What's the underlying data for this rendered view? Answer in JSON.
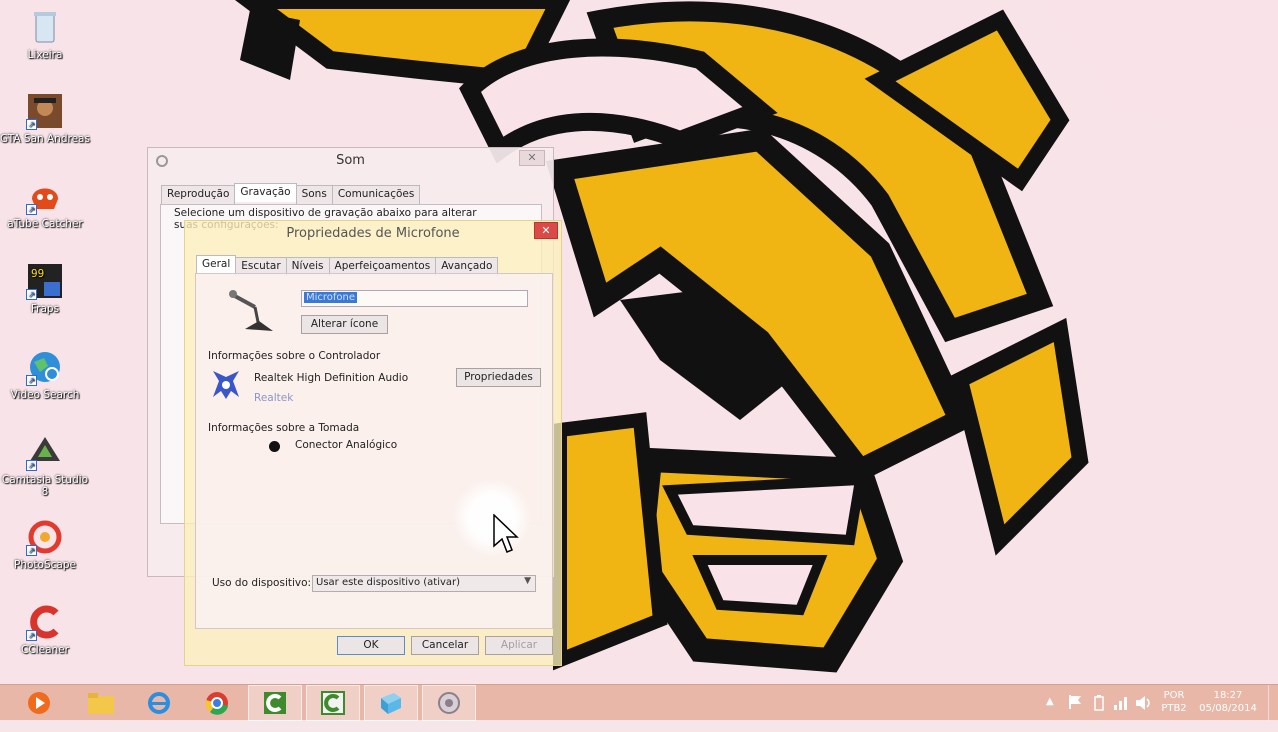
{
  "desktop": {
    "icons": [
      {
        "label": "Lixeira"
      },
      {
        "label": "GTA San Andreas"
      },
      {
        "label": "aTube Catcher"
      },
      {
        "label": "Fraps"
      },
      {
        "label": "Video Search"
      },
      {
        "label": "Camtasia Studio 8"
      },
      {
        "label": "PhotoScape"
      },
      {
        "label": "CCleaner"
      }
    ]
  },
  "som_window": {
    "title": "Som",
    "close_glyph": "✕",
    "tabs": [
      "Reprodução",
      "Gravação",
      "Sons",
      "Comunicações"
    ],
    "active_tab": "Gravação",
    "description": "Selecione um dispositivo de gravação abaixo para alterar suas configurações:"
  },
  "props_window": {
    "title": "Propriedades de Microfone",
    "close_glyph": "✕",
    "tabs": [
      "Geral",
      "Escutar",
      "Níveis",
      "Aperfeiçoamentos",
      "Avançado"
    ],
    "active_tab": "Geral",
    "name_value": "Microfone",
    "change_icon_label": "Alterar ícone",
    "controller_section": "Informações sobre o Controlador",
    "controller_name": "Realtek High Definition Audio",
    "controller_vendor": "Realtek",
    "properties_button": "Propriedades",
    "jack_section": "Informações sobre a Tomada",
    "jack_name": "Conector Analógico",
    "device_usage_label": "Uso do dispositivo:",
    "device_usage_value": "Usar este dispositivo (ativar)",
    "ok_label": "OK",
    "cancel_label": "Cancelar",
    "apply_label": "Aplicar"
  },
  "taskbar": {
    "language_top": "POR",
    "language_bottom": "PTB2",
    "time": "18:27",
    "date": "05/08/2014"
  },
  "colors": {
    "wallpaper_orange": "#f0b413",
    "wallpaper_black": "#111111",
    "wallpaper_pink": "#f9e2e8",
    "taskbar": "#e9b7a8"
  }
}
